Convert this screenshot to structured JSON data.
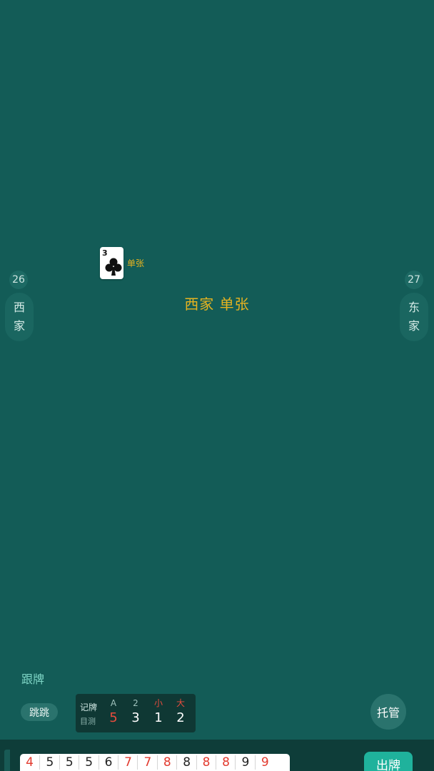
{
  "players": {
    "west": {
      "name_line1": "西",
      "name_line2": "家",
      "card_count": "26"
    },
    "east": {
      "name_line1": "东",
      "name_line2": "家",
      "card_count": "27"
    }
  },
  "played": {
    "card_rank": "3",
    "card_suit": "clubs",
    "label": "单张"
  },
  "center_message": "西家 单张",
  "action_hint": "跟牌",
  "skip_button": "跳跳",
  "card_tracker": {
    "title": "记牌",
    "subtitle": "目测",
    "columns": [
      {
        "header": "A",
        "value": "5"
      },
      {
        "header": "2",
        "value": "3"
      },
      {
        "header": "小",
        "value": "1"
      },
      {
        "header": "大",
        "value": "2"
      }
    ]
  },
  "auto_button": "托管",
  "play_button": "出牌",
  "hand": [
    {
      "rank": "4",
      "red": true
    },
    {
      "rank": "5",
      "red": false
    },
    {
      "rank": "5",
      "red": false
    },
    {
      "rank": "5",
      "red": false
    },
    {
      "rank": "6",
      "red": false
    },
    {
      "rank": "7",
      "red": true
    },
    {
      "rank": "7",
      "red": true
    },
    {
      "rank": "8",
      "red": true
    },
    {
      "rank": "8",
      "red": false
    },
    {
      "rank": "8",
      "red": true
    },
    {
      "rank": "8",
      "red": true
    },
    {
      "rank": "9",
      "red": false
    },
    {
      "rank": "9",
      "red": true
    }
  ],
  "colors": {
    "table_bg": "#135c57",
    "accent_gold": "#e6b320",
    "accent_teal": "#1fb29c",
    "red_suit": "#e23a2e"
  }
}
